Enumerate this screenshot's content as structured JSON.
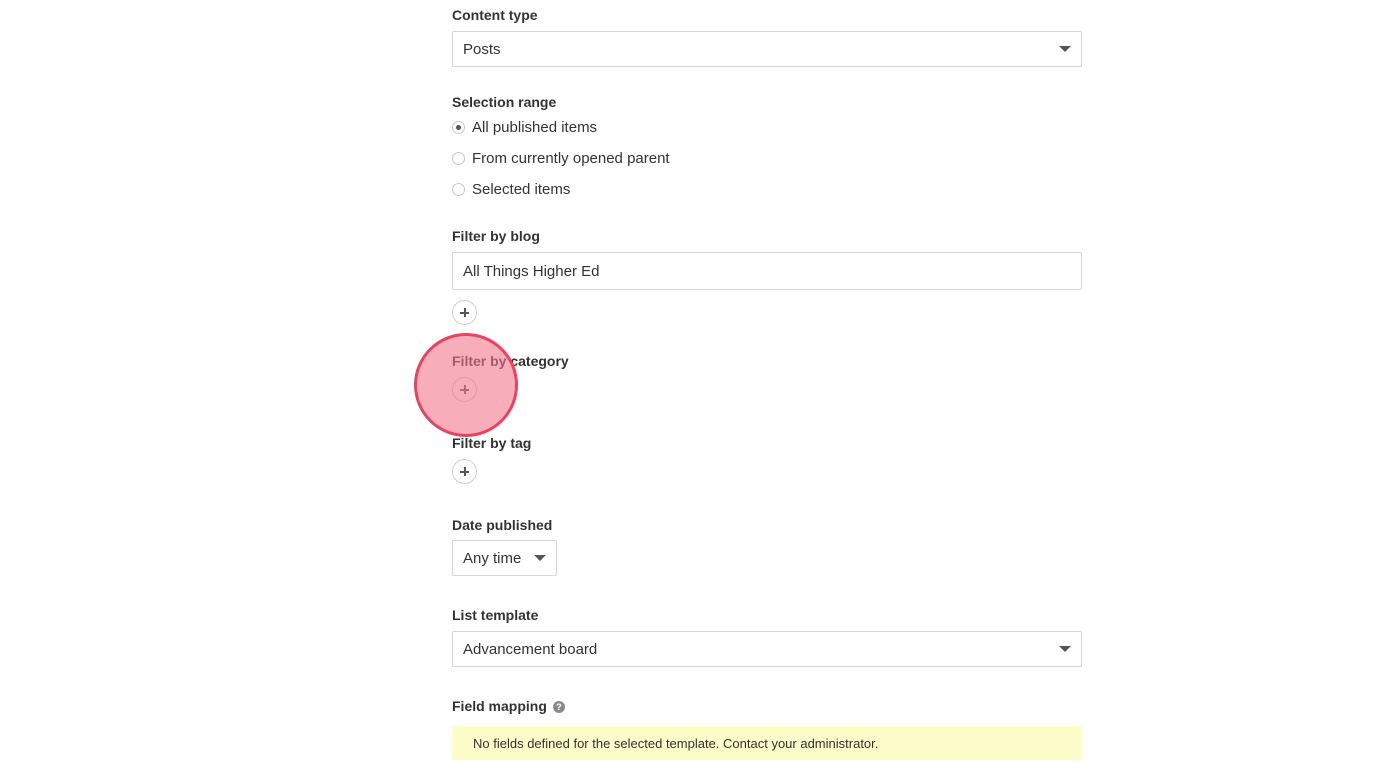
{
  "content_type": {
    "label": "Content type",
    "value": "Posts"
  },
  "selection_range": {
    "label": "Selection range",
    "options": [
      {
        "label": "All published items",
        "checked": true
      },
      {
        "label": "From currently opened parent",
        "checked": false
      },
      {
        "label": "Selected items",
        "checked": false
      }
    ]
  },
  "filter_blog": {
    "label": "Filter by blog",
    "value": "All Things Higher Ed"
  },
  "filter_category": {
    "label": "Filter by category"
  },
  "filter_tag": {
    "label": "Filter by tag"
  },
  "date_published": {
    "label": "Date published",
    "value": "Any time"
  },
  "list_template": {
    "label": "List template",
    "value": "Advancement board"
  },
  "field_mapping": {
    "label": "Field mapping",
    "help_glyph": "?",
    "notice": "No fields defined for the selected template. Contact your administrator."
  },
  "icons": {
    "add": "plus-icon",
    "caret": "chevron-down-icon",
    "help": "question-circle-icon"
  },
  "colors": {
    "notice_bg": "#fdfdc9",
    "click_indicator": "#e8435f"
  }
}
